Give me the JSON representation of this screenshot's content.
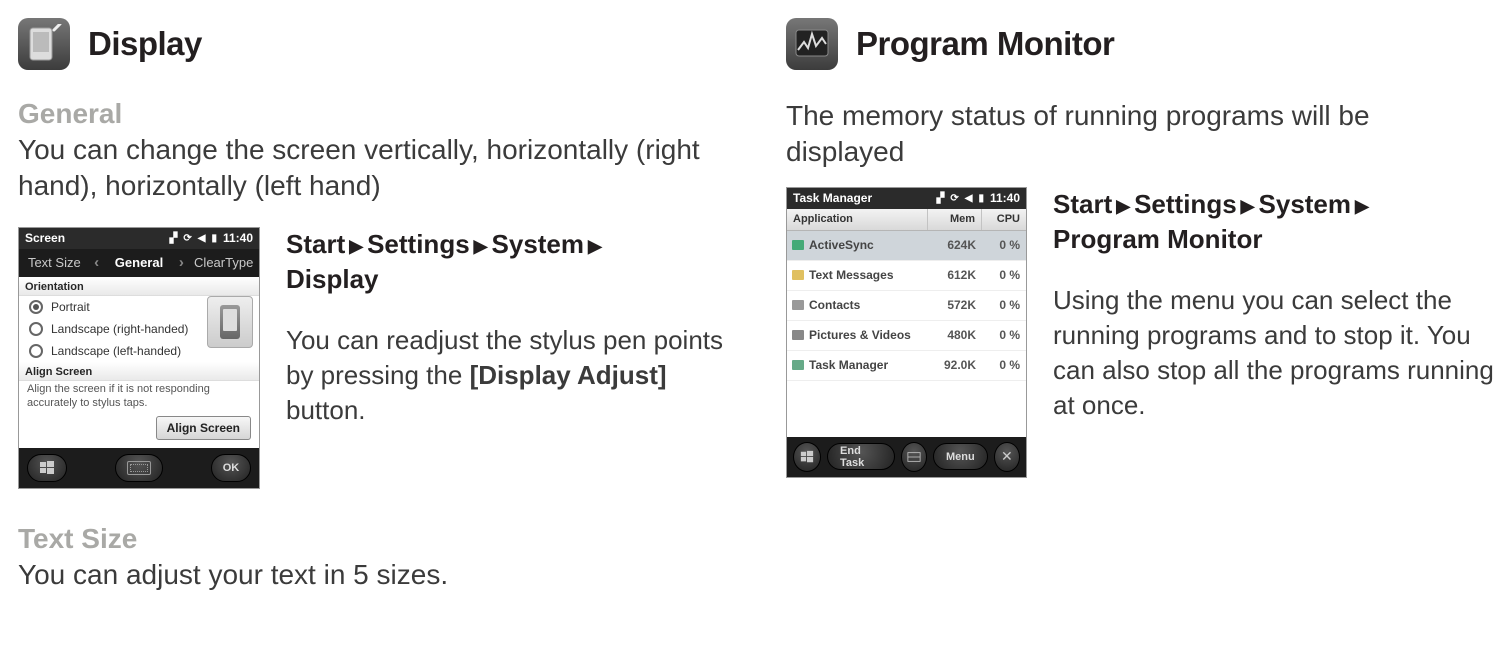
{
  "left": {
    "section_title": "Display",
    "general": {
      "heading": "General",
      "body": "You can change the screen vertically, horizontally (right hand), horizontally (left hand)"
    },
    "breadcrumb": {
      "p1": "Start",
      "p2": "Settings",
      "p3": "System",
      "p4": "Display"
    },
    "instr": {
      "line1": "You can readjust the stylus pen points by pressing the ",
      "bold": "[Display Adjust]",
      "line2": " button."
    },
    "textsize": {
      "heading": "Text Size",
      "body": "You can adjust your text in 5 sizes."
    },
    "shot": {
      "statusbar_title": "Screen",
      "time": "11:40",
      "tab_left": "Text Size",
      "tab_mid": "General",
      "tab_right": "ClearType",
      "orientation_label": "Orientation",
      "r1": "Portrait",
      "r2": "Landscape (right-handed)",
      "r3": "Landscape (left-handed)",
      "align_label": "Align Screen",
      "align_text": "Align the screen if it is not responding accurately to stylus taps.",
      "align_btn": "Align Screen",
      "ok": "OK"
    }
  },
  "right": {
    "section_title": "Program Monitor",
    "intro": "The memory status of running programs will be displayed",
    "breadcrumb": {
      "p1": "Start",
      "p2": "Settings",
      "p3": "System",
      "p4": "Program Monitor"
    },
    "instr": "Using the menu you can select the running programs and to stop it. You can also stop all the programs running at once.",
    "shot": {
      "statusbar_title": "Task Manager",
      "time": "11:40",
      "col_app": "Application",
      "col_mem": "Mem",
      "col_cpu": "CPU",
      "rows": [
        {
          "name": "ActiveSync",
          "mem": "624K",
          "cpu": "0 %"
        },
        {
          "name": "Text Messages",
          "mem": "612K",
          "cpu": "0 %"
        },
        {
          "name": "Contacts",
          "mem": "572K",
          "cpu": "0 %"
        },
        {
          "name": "Pictures & Videos",
          "mem": "480K",
          "cpu": "0 %"
        },
        {
          "name": "Task Manager",
          "mem": "92.0K",
          "cpu": "0 %"
        }
      ],
      "end_task": "End Task",
      "menu": "Menu"
    }
  }
}
